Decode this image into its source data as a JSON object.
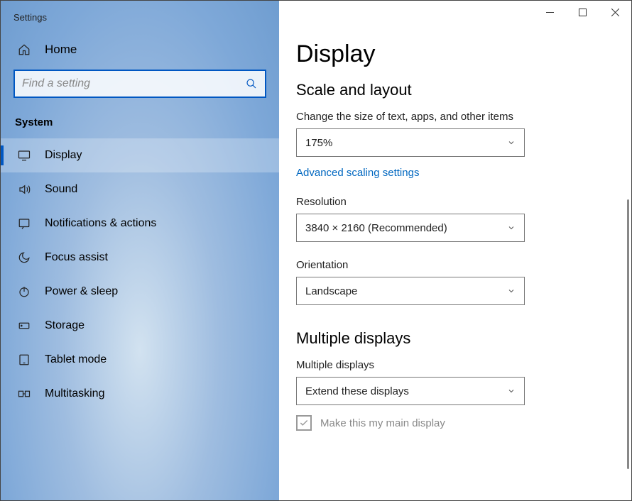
{
  "window": {
    "title": "Settings"
  },
  "sidebar": {
    "home_label": "Home",
    "search_placeholder": "Find a setting",
    "section_label": "System",
    "items": [
      {
        "label": "Display"
      },
      {
        "label": "Sound"
      },
      {
        "label": "Notifications & actions"
      },
      {
        "label": "Focus assist"
      },
      {
        "label": "Power & sleep"
      },
      {
        "label": "Storage"
      },
      {
        "label": "Tablet mode"
      },
      {
        "label": "Multitasking"
      }
    ]
  },
  "page": {
    "title": "Display",
    "sections": {
      "scale": {
        "heading": "Scale and layout",
        "text_size_label": "Change the size of text, apps, and other items",
        "text_size_value": "175%",
        "advanced_link": "Advanced scaling settings",
        "resolution_label": "Resolution",
        "resolution_value": "3840 × 2160 (Recommended)",
        "orientation_label": "Orientation",
        "orientation_value": "Landscape"
      },
      "multi": {
        "heading": "Multiple displays",
        "mode_label": "Multiple displays",
        "mode_value": "Extend these displays",
        "main_display_label": "Make this my main display"
      }
    }
  }
}
